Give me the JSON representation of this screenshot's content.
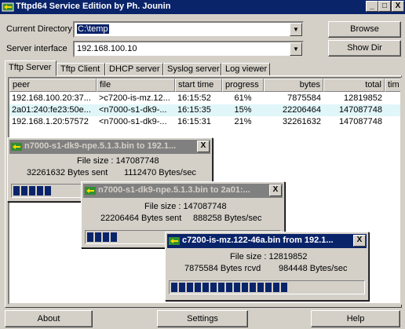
{
  "window": {
    "title": "Tftpd64 Service Edition by Ph. Jounin",
    "minimize_glyph": "_",
    "maximize_glyph": "□",
    "close_glyph": "X"
  },
  "form": {
    "current_directory_label": "Current Directory",
    "current_directory_value": "C:\\temp",
    "server_interface_label": "Server interface",
    "server_interface_value": "192.168.100.10",
    "browse_label": "Browse",
    "show_dir_label": "Show Dir"
  },
  "tabs": [
    {
      "label": "Tftp Server",
      "active": true
    },
    {
      "label": "Tftp Client",
      "active": false
    },
    {
      "label": "DHCP server",
      "active": false
    },
    {
      "label": "Syslog server",
      "active": false
    },
    {
      "label": "Log viewer",
      "active": false
    }
  ],
  "table": {
    "columns": [
      "peer",
      "file",
      "start time",
      "progress",
      "bytes",
      "total",
      "tim"
    ],
    "rows": [
      {
        "peer": "192.168.100.20:37...",
        "file": ">c7200-is-mz.12...",
        "start_time": "16:15:52",
        "progress": "61%",
        "bytes": "7875584",
        "total": "12819852",
        "highlight": false
      },
      {
        "peer": "2a01:240:fe23:50e...",
        "file": "<n7000-s1-dk9-...",
        "start_time": "16:15:35",
        "progress": "15%",
        "bytes": "22206464",
        "total": "147087748",
        "highlight": true
      },
      {
        "peer": "192.168.1.20:57572",
        "file": "<n7000-s1-dk9-...",
        "start_time": "16:15:31",
        "progress": "21%",
        "bytes": "32261632",
        "total": "147087748",
        "highlight": false
      }
    ]
  },
  "transfers": [
    {
      "title": "n7000-s1-dk9-npe.5.1.3.bin to 192.1...",
      "file_size": "File size : 147087748",
      "bytes": "32261632 Bytes sent",
      "rate": "1112470 Bytes/sec",
      "progress": 0.21
    },
    {
      "title": "n7000-s1-dk9-npe.5.1.3.bin to 2a01:...",
      "file_size": "File size : 147087748",
      "bytes": "22206464 Bytes sent",
      "rate": "888258 Bytes/sec",
      "progress": 0.15
    },
    {
      "title": "c7200-is-mz.122-46a.bin from 192.1...",
      "file_size": "File size : 12819852",
      "bytes": "7875584 Bytes rcvd",
      "rate": "984448 Bytes/sec",
      "progress": 0.61
    }
  ],
  "bottom": {
    "about_label": "About",
    "settings_label": "Settings",
    "help_label": "Help"
  },
  "colors": {
    "title_active": "#0a246a",
    "title_inactive": "#808080",
    "face": "#d4d0c8",
    "progress": "#0a246a",
    "row_highlight": "#e0f6f8"
  },
  "icons": {
    "app": "tftpd-network-icon",
    "transfer": "green-transfer-icon",
    "dropdown": "down-triangle"
  }
}
